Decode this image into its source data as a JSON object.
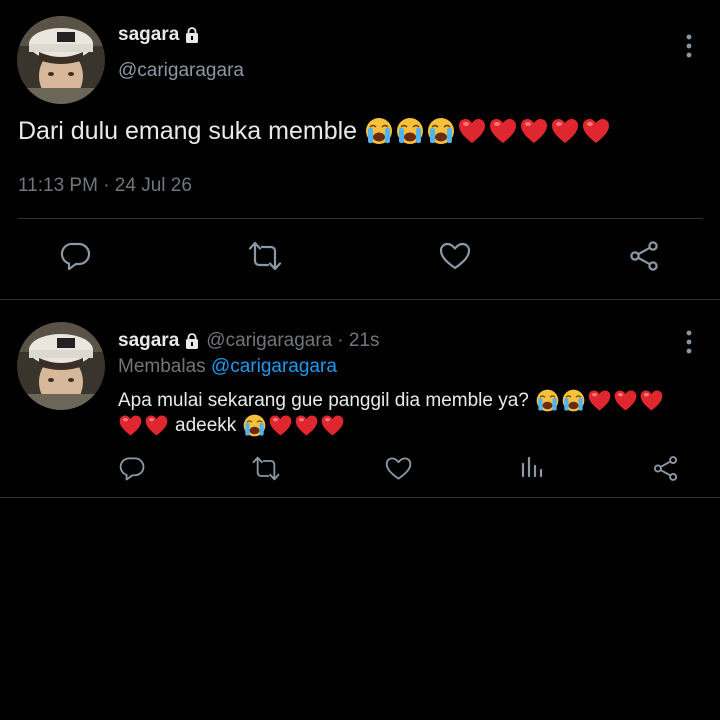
{
  "main_tweet": {
    "display_name": "sagara",
    "handle": "@carigaragara",
    "text": "Dari dulu emang suka memble",
    "emojis": [
      "loudly-crying-face",
      "loudly-crying-face",
      "loudly-crying-face",
      "red-heart",
      "red-heart",
      "red-heart",
      "red-heart",
      "red-heart"
    ],
    "timestamp": "11:13 PM · 24 Jul 26",
    "actions": [
      "reply-icon",
      "retweet-icon",
      "like-icon",
      "share-icon"
    ]
  },
  "reply_tweet": {
    "display_name": "sagara",
    "handle": "@carigaragara",
    "time_ago": "· 21s",
    "replying_prefix": "Membalas",
    "replying_to": "@carigaragara",
    "text_line1": "Apa mulai sekarang gue panggil dia memble ya?",
    "line1_emojis": [
      "loudly-crying-face",
      "loudly-crying-face",
      "red-heart",
      "red-heart",
      "red-heart"
    ],
    "line2_emojis_before": [
      "red-heart",
      "red-heart"
    ],
    "text_line2": "adeekk",
    "line2_emojis_after": [
      "loudly-crying-face",
      "red-heart",
      "red-heart",
      "red-heart"
    ],
    "actions": [
      "reply-icon",
      "retweet-icon",
      "like-icon",
      "views-icon",
      "share-icon"
    ]
  },
  "colors": {
    "background": "#000000",
    "text": "#e7e9ea",
    "secondary": "#71767b",
    "link": "#1d9bf0",
    "divider": "#2f3336"
  }
}
